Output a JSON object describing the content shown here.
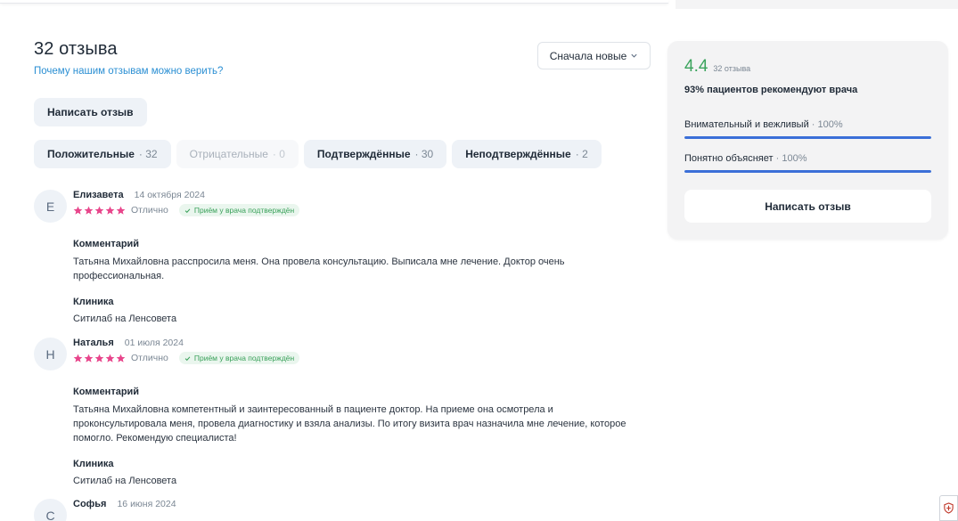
{
  "header": {
    "title": "32 отзыва",
    "trust_link": "Почему нашим отзывам можно верить?",
    "sort_label": "Сначала новые",
    "write_review": "Написать отзыв"
  },
  "filters": [
    {
      "label": "Положительные",
      "count": "· 32",
      "enabled": true
    },
    {
      "label": "Отрицательные",
      "count": "· 0",
      "enabled": false
    },
    {
      "label": "Подтверждённые",
      "count": "· 30",
      "enabled": true
    },
    {
      "label": "Неподтверждённые",
      "count": "· 2",
      "enabled": true
    }
  ],
  "reviews": [
    {
      "initial": "Е",
      "name": "Елизавета",
      "date": "14 октября 2024",
      "stars": 5,
      "rating_word": "Отлично",
      "verified": "Приём у врача подтверждён",
      "comment_label": "Комментарий",
      "comment_line1": "Татьяна Михайловна расспросила меня. Она провела консультацию. Выписала мне лечение. Доктор очень",
      "comment_line2": "профессиональная.",
      "clinic_label": "Клиника",
      "clinic": "Ситилаб на Ленсовета"
    },
    {
      "initial": "Н",
      "name": "Наталья",
      "date": "01 июля 2024",
      "stars": 5,
      "rating_word": "Отлично",
      "verified": "Приём у врача подтверждён",
      "comment_label": "Комментарий",
      "comment_line1": "Татьяна Михайловна компетентный и заинтересованный в пациенте доктор. На приеме она осмотрела и",
      "comment_line2": "проконсультировала меня, провела диагностику и взяла анализы. По итогу визита врач назначила мне лечение, которое",
      "comment_line3": "помогло. Рекомендую специалиста!",
      "clinic_label": "Клиника",
      "clinic": "Ситилаб на Ленсовета"
    },
    {
      "initial": "С",
      "name": "Софья",
      "date": "16 июня 2024"
    }
  ],
  "summary": {
    "score": "4.4",
    "reviews_count": "32 отзыва",
    "recommend": "93% пациентов рекомендуют врача",
    "metrics": [
      {
        "label": "Внимательный и вежливый",
        "pct": "· 100%",
        "value": 100
      },
      {
        "label": "Понятно объясняет",
        "pct": "· 100%",
        "value": 100
      }
    ],
    "write_review": "Написать отзыв"
  },
  "colors": {
    "accent_green": "#3aa35c",
    "star_pink": "#e8458b",
    "link_blue": "#2b8fd3",
    "bar_blue": "#3b6fd8"
  },
  "icons": [
    "chevron-down-icon",
    "star-icon",
    "check-icon",
    "extension-icon"
  ]
}
